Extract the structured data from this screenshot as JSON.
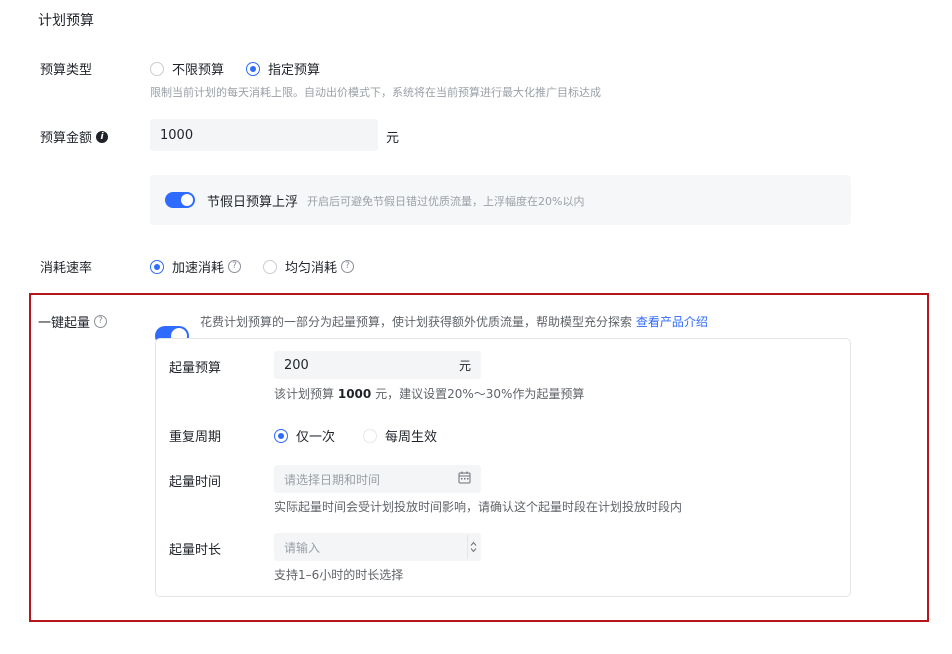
{
  "section_title": "计划预算",
  "budget_type": {
    "label": "预算类型",
    "options": [
      "不限预算",
      "指定预算"
    ],
    "selected": "指定预算",
    "help": "限制当前计划的每天消耗上限。自动出价模式下，系统将在当前预算进行最大化推广目标达成"
  },
  "budget_amount": {
    "label": "预算金额",
    "info_icon": "i",
    "value": "1000",
    "unit": "元"
  },
  "holiday": {
    "enabled": true,
    "label": "节假日预算上浮",
    "help": "开启后可避免节假日错过优质流量，上浮幅度在20%以内"
  },
  "spend_rate": {
    "label": "消耗速率",
    "options": [
      "加速消耗",
      "均匀消耗"
    ],
    "selected": "加速消耗",
    "help_glyph": "?"
  },
  "boost": {
    "label": "一键起量",
    "help_glyph": "?",
    "enabled": true,
    "desc": "花费计划预算的一部分为起量预算，使计划获得额外优质流量，帮助模型充分探索",
    "link": "查看产品介绍",
    "budget": {
      "label": "起量预算",
      "value": "200",
      "unit": "元",
      "hint_prefix": "该计划预算",
      "hint_amount": "1000",
      "hint_suffix": "元，建议设置20%～30%作为起量预算"
    },
    "cycle": {
      "label": "重复周期",
      "options": [
        "仅一次",
        "每周生效"
      ],
      "selected": "仅一次"
    },
    "time": {
      "label": "起量时间",
      "placeholder": "请选择日期和时间",
      "hint": "实际起量时间会受计划投放时间影响，请确认这个起量时段在计划投放时段内"
    },
    "duration": {
      "label": "起量时长",
      "placeholder": "请输入",
      "hint": "支持1–6小时的时长选择"
    }
  },
  "colors": {
    "accent": "#2f6bff",
    "highlight_frame": "#b4161b"
  }
}
